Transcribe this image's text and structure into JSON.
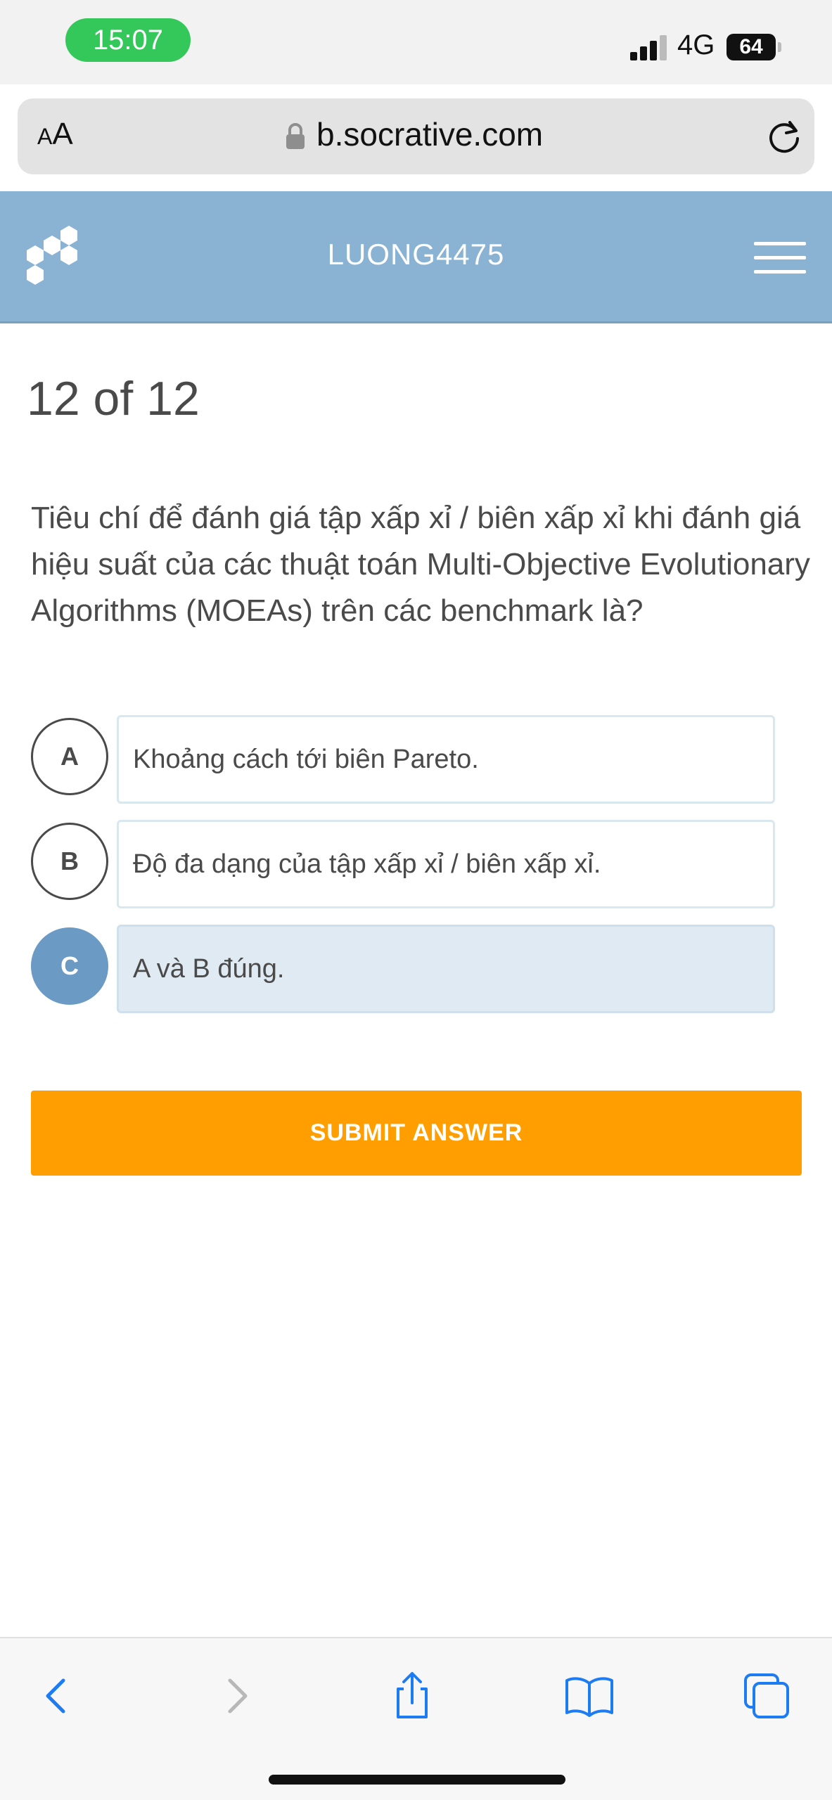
{
  "status_bar": {
    "time": "15:07",
    "network": "4G",
    "battery": "64",
    "colors": {
      "time_pill": "#34c759"
    }
  },
  "browser": {
    "text_size_label": "AA",
    "url": "b.socrative.com",
    "icons": [
      "lock-icon",
      "reload-icon"
    ]
  },
  "app_header": {
    "room_name": "LUONG4475",
    "background": "#8ab2d3",
    "icons": [
      "socrative-logo-icon",
      "hamburger-menu-icon"
    ]
  },
  "quiz": {
    "progress": "12 of 12",
    "question": "Tiêu chí để đánh giá tập xấp xỉ / biên xấp xỉ khi đánh giá hiệu suất của các thuật toán Multi-Objective Evolutionary Algorithms (MOEAs) trên các benchmark là?",
    "options": [
      {
        "letter": "A",
        "text": "Khoảng cách tới biên Pareto.",
        "selected": false
      },
      {
        "letter": "B",
        "text": "Độ đa dạng của tập xấp xỉ / biên xấp xỉ.",
        "selected": false
      },
      {
        "letter": "C",
        "text": "A và B đúng.",
        "selected": true
      }
    ],
    "submit_label": "SUBMIT ANSWER",
    "submit_color": "#fe9e00",
    "selected_color": "#6b9ac4"
  },
  "toolbar": {
    "icons": [
      "back-icon",
      "forward-icon",
      "share-icon",
      "bookmarks-icon",
      "tabs-icon"
    ]
  }
}
